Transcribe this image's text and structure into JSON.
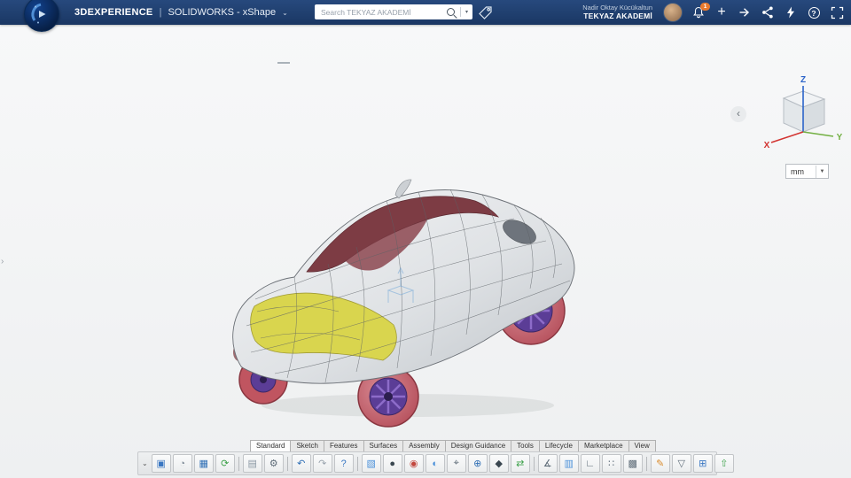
{
  "top_bar": {
    "brand": "3DEXPERIENCE",
    "brand_separator": "|",
    "app_name": "SOLIDWORKS - xShape",
    "app_menu_chevron": "⌄",
    "search": {
      "placeholder": "Search TEKYAZ AKADEMİ",
      "dropdown_chevron": "▾"
    },
    "user": {
      "name": "Nadir Oktay Kücükaltun",
      "org": "TEKYAZ AKADEMİ"
    },
    "notifications": {
      "badge_count": "1"
    },
    "plus_glyph": "+",
    "help_glyph": "?"
  },
  "viewport": {
    "units_selector": {
      "value": "mm",
      "chevron": "▼"
    },
    "axes": {
      "x": "X",
      "y": "Y",
      "z": "Z"
    },
    "axis_colors": {
      "x": "#d23431",
      "y": "#73b043",
      "z": "#2a63c9"
    },
    "back_chevron": "‹",
    "left_edge_chevron": "›"
  },
  "model": {
    "description": "Concept car subdivision surface model",
    "body_color": "#dfe2e5",
    "roof_color": "#7d3c44",
    "front_panel_color": "#d9d54e",
    "wheel_rim_color": "#5b3d96",
    "tire_color": "#c05560"
  },
  "ribbon": {
    "tabs": [
      {
        "label": "Standard",
        "active": true
      },
      {
        "label": "Sketch"
      },
      {
        "label": "Features"
      },
      {
        "label": "Surfaces"
      },
      {
        "label": "Assembly"
      },
      {
        "label": "Design Guidance"
      },
      {
        "label": "Tools"
      },
      {
        "label": "Lifecycle"
      },
      {
        "label": "Marketplace"
      },
      {
        "label": "View"
      }
    ]
  },
  "toolbar": {
    "overflow_chevron": "⌄",
    "items": [
      {
        "type": "icon",
        "name": "insert-design",
        "glyph": "▣",
        "color": "#3a77c2"
      },
      {
        "type": "icon",
        "name": "physical-product",
        "glyph": "◔",
        "color": "#7d8a96"
      },
      {
        "type": "icon",
        "name": "save",
        "glyph": "▦",
        "color": "#2f6fb5"
      },
      {
        "type": "icon",
        "name": "refresh",
        "glyph": "⟳",
        "color": "#3da14a"
      },
      {
        "type": "sep"
      },
      {
        "type": "icon",
        "name": "clipboard",
        "glyph": "▤",
        "color": "#8a97a3"
      },
      {
        "type": "icon",
        "name": "settings-gear",
        "glyph": "⚙",
        "color": "#5d6b77"
      },
      {
        "type": "sep"
      },
      {
        "type": "icon",
        "name": "undo",
        "glyph": "↶",
        "color": "#2f6fb5"
      },
      {
        "type": "icon",
        "name": "redo",
        "glyph": "↷",
        "color": "#9aa4ae"
      },
      {
        "type": "icon",
        "name": "help",
        "glyph": "?",
        "color": "#3a77c2"
      },
      {
        "type": "sep"
      },
      {
        "type": "icon",
        "name": "render-image",
        "glyph": "▧",
        "color": "#4a90d9"
      },
      {
        "type": "icon",
        "name": "material-sphere",
        "glyph": "●",
        "color": "#3a4750"
      },
      {
        "type": "icon",
        "name": "color-wheel",
        "glyph": "◉",
        "color": "#c2483f"
      },
      {
        "type": "icon",
        "name": "appearance-sphere",
        "glyph": "◐",
        "color": "#4a90d9"
      },
      {
        "type": "icon",
        "name": "snap-target",
        "glyph": "⌖",
        "color": "#5d6b77"
      },
      {
        "type": "icon",
        "name": "move-manipulator",
        "glyph": "⊕",
        "color": "#2f6fb5"
      },
      {
        "type": "icon",
        "name": "transform",
        "glyph": "◆",
        "color": "#3a4750"
      },
      {
        "type": "icon",
        "name": "compare",
        "glyph": "⇄",
        "color": "#3da14a"
      },
      {
        "type": "sep"
      },
      {
        "type": "icon",
        "name": "measure",
        "glyph": "∡",
        "color": "#5d6b77"
      },
      {
        "type": "icon",
        "name": "section-view",
        "glyph": "▥",
        "color": "#4a90d9"
      },
      {
        "type": "icon",
        "name": "align",
        "glyph": "∟",
        "color": "#5d6b77"
      },
      {
        "type": "icon",
        "name": "pattern",
        "glyph": "∷",
        "color": "#5d6b77"
      },
      {
        "type": "icon",
        "name": "wireframe",
        "glyph": "▩",
        "color": "#5d6b77"
      },
      {
        "type": "sep"
      },
      {
        "type": "icon",
        "name": "sketch-pencil",
        "glyph": "✎",
        "color": "#d98a2b"
      },
      {
        "type": "icon",
        "name": "filter",
        "glyph": "▽",
        "color": "#5d6b77"
      },
      {
        "type": "icon",
        "name": "grid-table",
        "glyph": "⊞",
        "color": "#3a77c2"
      },
      {
        "type": "icon",
        "name": "export-upload",
        "glyph": "⇧",
        "color": "#3da14a"
      }
    ]
  }
}
